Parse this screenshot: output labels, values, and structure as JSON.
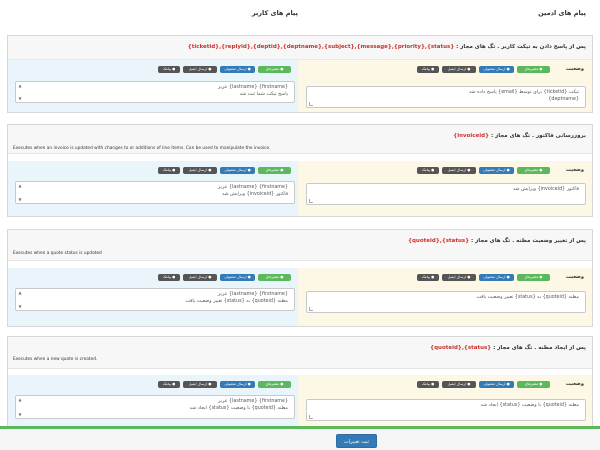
{
  "columns": {
    "admin": "پیام های ادمین",
    "user": "پیام های کاربر"
  },
  "buttons": {
    "status": "● متغیرهای",
    "normal": "● ارسال معمولی",
    "email": "● ارسال ایمیل",
    "sms": "● پیامک"
  },
  "status_label": "وضعیت",
  "sections": [
    {
      "title": "پس از پاسخ دادن به تیکت کاربر . تگ های مجاز :",
      "tags": "{status},{priority},{message},{subject},{deptname},{deptid},{replyid},{ticketid}",
      "description": "",
      "admin_text": [
        "تیکت {ticketid} برای توسط {email} پاسخ داده شد",
        "{deptname}"
      ],
      "user_text": [
        "{firstname} {lastname} عزیز",
        "پاسخ تیکت شما ثبت شد"
      ]
    },
    {
      "title": "بروزرسانی فاکتور . تگ های مجاز :",
      "tags": "{invoiceid}",
      "description": "Executes when an invoice is updated with changes to or additions of line items. Can be used to manipulate the invoice.",
      "admin_text": [
        "فاکتور {invoiceid} ویرایش شد"
      ],
      "user_text": [
        "{firstname} {lastname} عزیز",
        "فاکتور {invoiceid} ویرایش شد"
      ]
    },
    {
      "title": "پس از تغییر وضعیت مظنه . تگ های مجاز :",
      "tags": "{status},{quoteid}",
      "description": "Executes when a quote status is updated",
      "admin_text": [
        "مظنه {quoteid} به {status} تغییر وضعیت یافت"
      ],
      "user_text": [
        "{firstname} {lastname} عزیز",
        "مظنه {quoteid} به {status} تغییر وضعیت یافت"
      ]
    },
    {
      "title": "پس از ایجاد مظنه . تگ های مجاز :",
      "tags": "{status},{quoteid}",
      "description": "Executes when a new quote is created.",
      "admin_text": [
        "مظنه {quoteid} با وضعیت {status} ایجاد شد"
      ],
      "user_text": [
        "{firstname} {lastname} عزیز",
        "مظنه {quoteid} با وضعیت {status} ایجاد شد"
      ]
    }
  ],
  "footer": {
    "save_label": "ثبت تغییرات"
  }
}
